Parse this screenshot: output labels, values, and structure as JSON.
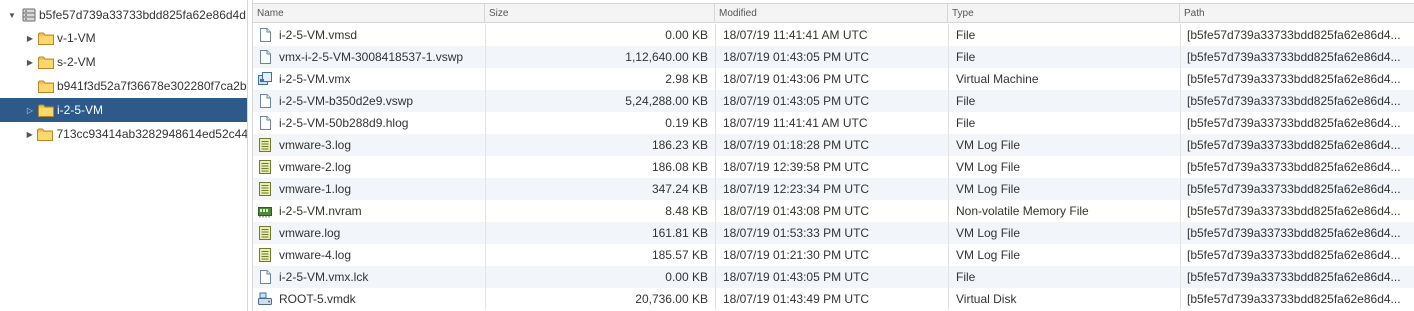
{
  "tree": {
    "root": {
      "label": "b5fe57d739a33733bdd825fa62e86d4d",
      "icon": "datastore-icon",
      "expanded": true
    },
    "children": [
      {
        "label": "v-1-VM",
        "has_toggle": true,
        "selected": false
      },
      {
        "label": "s-2-VM",
        "has_toggle": true,
        "selected": false
      },
      {
        "label": "b941f3d52a7f36678e302280f7ca2b",
        "has_toggle": false,
        "selected": false
      },
      {
        "label": "i-2-5-VM",
        "has_toggle": true,
        "selected": true
      },
      {
        "label": "713cc93414ab3282948614ed52c44",
        "has_toggle": true,
        "selected": false
      }
    ]
  },
  "grid": {
    "columns": [
      "Name",
      "Size",
      "Modified",
      "Type",
      "Path"
    ],
    "rows": [
      {
        "icon": "file-icon",
        "name": "i-2-5-VM.vmsd",
        "size": "0.00 KB",
        "modified": "18/07/19 11:41:41 AM UTC",
        "type": "File",
        "path": "[b5fe57d739a33733bdd825fa62e86d4..."
      },
      {
        "icon": "file-icon",
        "name": "vmx-i-2-5-VM-3008418537-1.vswp",
        "size": "1,12,640.00 KB",
        "modified": "18/07/19 01:43:05 PM UTC",
        "type": "File",
        "path": "[b5fe57d739a33733bdd825fa62e86d4..."
      },
      {
        "icon": "virtual-machine-icon",
        "name": "i-2-5-VM.vmx",
        "size": "2.98 KB",
        "modified": "18/07/19 01:43:06 PM UTC",
        "type": "Virtual Machine",
        "path": "[b5fe57d739a33733bdd825fa62e86d4..."
      },
      {
        "icon": "file-icon",
        "name": "i-2-5-VM-b350d2e9.vswp",
        "size": "5,24,288.00 KB",
        "modified": "18/07/19 01:43:05 PM UTC",
        "type": "File",
        "path": "[b5fe57d739a33733bdd825fa62e86d4..."
      },
      {
        "icon": "file-icon",
        "name": "i-2-5-VM-50b288d9.hlog",
        "size": "0.19 KB",
        "modified": "18/07/19 11:41:41 AM UTC",
        "type": "File",
        "path": "[b5fe57d739a33733bdd825fa62e86d4..."
      },
      {
        "icon": "log-file-icon",
        "name": "vmware-3.log",
        "size": "186.23 KB",
        "modified": "18/07/19 01:18:28 PM UTC",
        "type": "VM Log File",
        "path": "[b5fe57d739a33733bdd825fa62e86d4..."
      },
      {
        "icon": "log-file-icon",
        "name": "vmware-2.log",
        "size": "186.08 KB",
        "modified": "18/07/19 12:39:58 PM UTC",
        "type": "VM Log File",
        "path": "[b5fe57d739a33733bdd825fa62e86d4..."
      },
      {
        "icon": "log-file-icon",
        "name": "vmware-1.log",
        "size": "347.24 KB",
        "modified": "18/07/19 12:23:34 PM UTC",
        "type": "VM Log File",
        "path": "[b5fe57d739a33733bdd825fa62e86d4..."
      },
      {
        "icon": "nvram-icon",
        "name": "i-2-5-VM.nvram",
        "size": "8.48 KB",
        "modified": "18/07/19 01:43:08 PM UTC",
        "type": "Non-volatile Memory File",
        "path": "[b5fe57d739a33733bdd825fa62e86d4..."
      },
      {
        "icon": "log-file-icon",
        "name": "vmware.log",
        "size": "161.81 KB",
        "modified": "18/07/19 01:53:33 PM UTC",
        "type": "VM Log File",
        "path": "[b5fe57d739a33733bdd825fa62e86d4..."
      },
      {
        "icon": "log-file-icon",
        "name": "vmware-4.log",
        "size": "185.57 KB",
        "modified": "18/07/19 01:21:30 PM UTC",
        "type": "VM Log File",
        "path": "[b5fe57d739a33733bdd825fa62e86d4..."
      },
      {
        "icon": "file-icon",
        "name": "i-2-5-VM.vmx.lck",
        "size": "0.00 KB",
        "modified": "18/07/19 01:43:05 PM UTC",
        "type": "File",
        "path": "[b5fe57d739a33733bdd825fa62e86d4..."
      },
      {
        "icon": "virtual-disk-icon",
        "name": "ROOT-5.vmdk",
        "size": "20,736.00 KB",
        "modified": "18/07/19 01:43:49 PM UTC",
        "type": "Virtual Disk",
        "path": "[b5fe57d739a33733bdd825fa62e86d4..."
      }
    ]
  },
  "colors": {
    "selected_row": "#2d5a8a",
    "alt_row": "#f2f5f9",
    "folder": "#f5c445"
  }
}
